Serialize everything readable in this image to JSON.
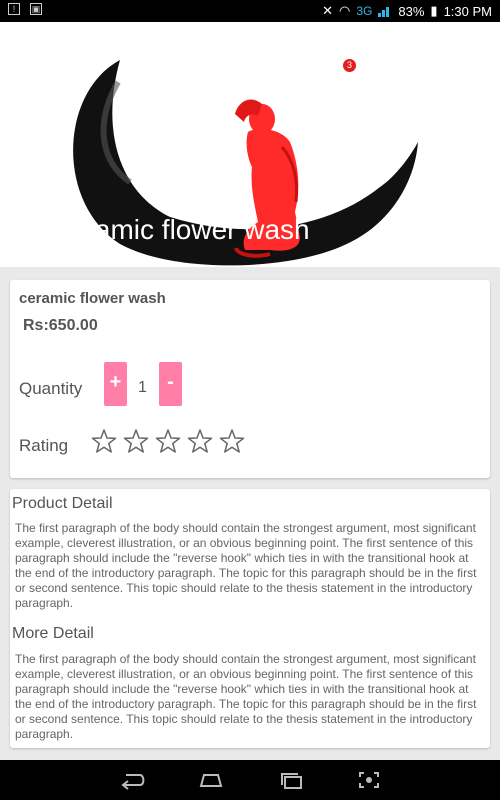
{
  "status_bar": {
    "network": "3G",
    "battery": "83%",
    "time": "1:30 PM"
  },
  "hero": {
    "title": "ceramic flower wash",
    "cart_badge": "3"
  },
  "product": {
    "name": "ceramic flower wash",
    "price": "Rs:650.00",
    "quantity_label": "Quantity",
    "plus_label": "+",
    "minus_label": "-",
    "quantity_value": "1",
    "rating_label": "Rating",
    "rating_value": 0,
    "rating_max": 5
  },
  "details": {
    "product_detail_heading": "Product Detail",
    "product_detail_text": "The first paragraph of the body should contain the strongest argument, most significant example, cleverest illustration, or an obvious beginning point. The first sentence of this paragraph should include the \"reverse hook\" which ties in with the transitional hook at the end of the introductory paragraph. The topic for this paragraph should be in the first or second sentence. This topic should relate to the thesis statement in the introductory paragraph.",
    "more_detail_heading": "More Detail",
    "more_detail_text": "The first paragraph of the body should contain the strongest argument, most significant example, cleverest illustration, or an obvious beginning point. The first sentence of this paragraph should include the \"reverse hook\" which ties in with the transitional hook at the end of the introductory paragraph. The topic for this paragraph should be in the first or second sentence. This topic should relate to the thesis statement in the introductory paragraph."
  },
  "colors": {
    "accent_pink": "#ff7fa9",
    "badge_red": "#e41d1d",
    "network_blue": "#33b5e5"
  },
  "icons": {
    "star": "star-outline-icon",
    "back": "back-icon",
    "home": "home-icon",
    "recents": "recent-apps-icon",
    "screenshot": "screenshot-icon"
  }
}
